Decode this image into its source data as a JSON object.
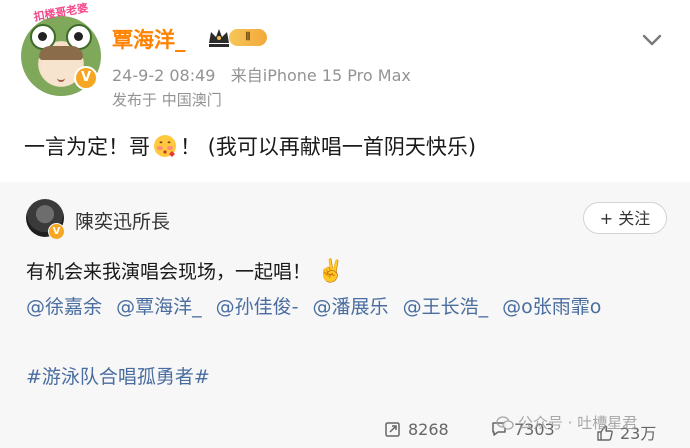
{
  "post": {
    "avatar_label": "扣楼哥老婆",
    "verified_mark": "V",
    "username": "覃海洋_",
    "level_badge": "Ⅱ",
    "timestamp": "24-9-2 08:49",
    "source": "来自iPhone 15 Pro Max",
    "location": "发布于 中国澳门",
    "text_before_emoji": "一言为定！哥",
    "text_after_emoji": "！ (我可以再献唱一首阴天快乐)"
  },
  "repost": {
    "verified_mark": "V",
    "username": "陳奕迅所長",
    "follow_label": "+ 关注",
    "text": "有机会来我演唱会现场，一起唱！",
    "emoji": "✌️",
    "mentions": [
      "@徐嘉余",
      "@覃海洋_",
      "@孙佳俊-",
      "@潘展乐",
      "@王长浩_",
      "@o张雨霏o"
    ],
    "hashtag": "#游泳队合唱孤勇者#"
  },
  "actions": {
    "repost_count": "8268",
    "comment_count": "7303",
    "like_count": "23万"
  },
  "watermark": {
    "text": "公众号 · 吐槽星君"
  },
  "colors": {
    "username": "#ff8200",
    "link": "#4a6da0",
    "meta": "#939393",
    "card_bg": "#f7f7f7"
  }
}
